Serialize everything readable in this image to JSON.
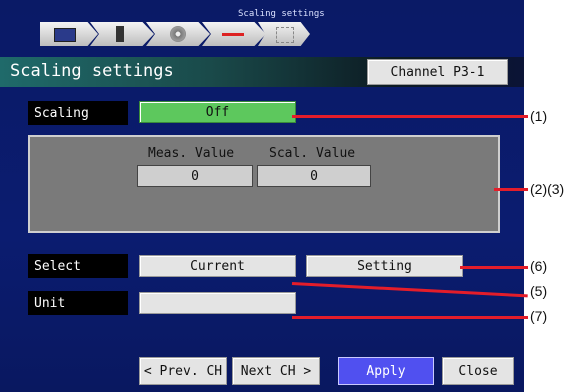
{
  "breadcrumb": {
    "title": "Scaling settings"
  },
  "page": {
    "title": "Scaling settings",
    "channel_button": "Channel P3-1"
  },
  "scaling": {
    "label": "Scaling",
    "value": "Off",
    "value_color": "#5dc85d"
  },
  "panel": {
    "meas_header": "Meas. Value",
    "scal_header": "Scal. Value",
    "meas_value": "0",
    "scal_value": "0"
  },
  "select": {
    "label": "Select",
    "current_button": "Current",
    "setting_button": "Setting"
  },
  "unit": {
    "label": "Unit",
    "value": ""
  },
  "footer": {
    "prev": "< Prev. CH",
    "next": "Next CH >",
    "apply": "Apply",
    "close": "Close"
  },
  "callouts": [
    "(1)",
    "(2)(3)",
    "(6)",
    "(5)",
    "(7)"
  ],
  "colors": {
    "screen_bg": "#0b1c70",
    "apply_bg": "#5050f0",
    "callout": "#e41d2a"
  }
}
